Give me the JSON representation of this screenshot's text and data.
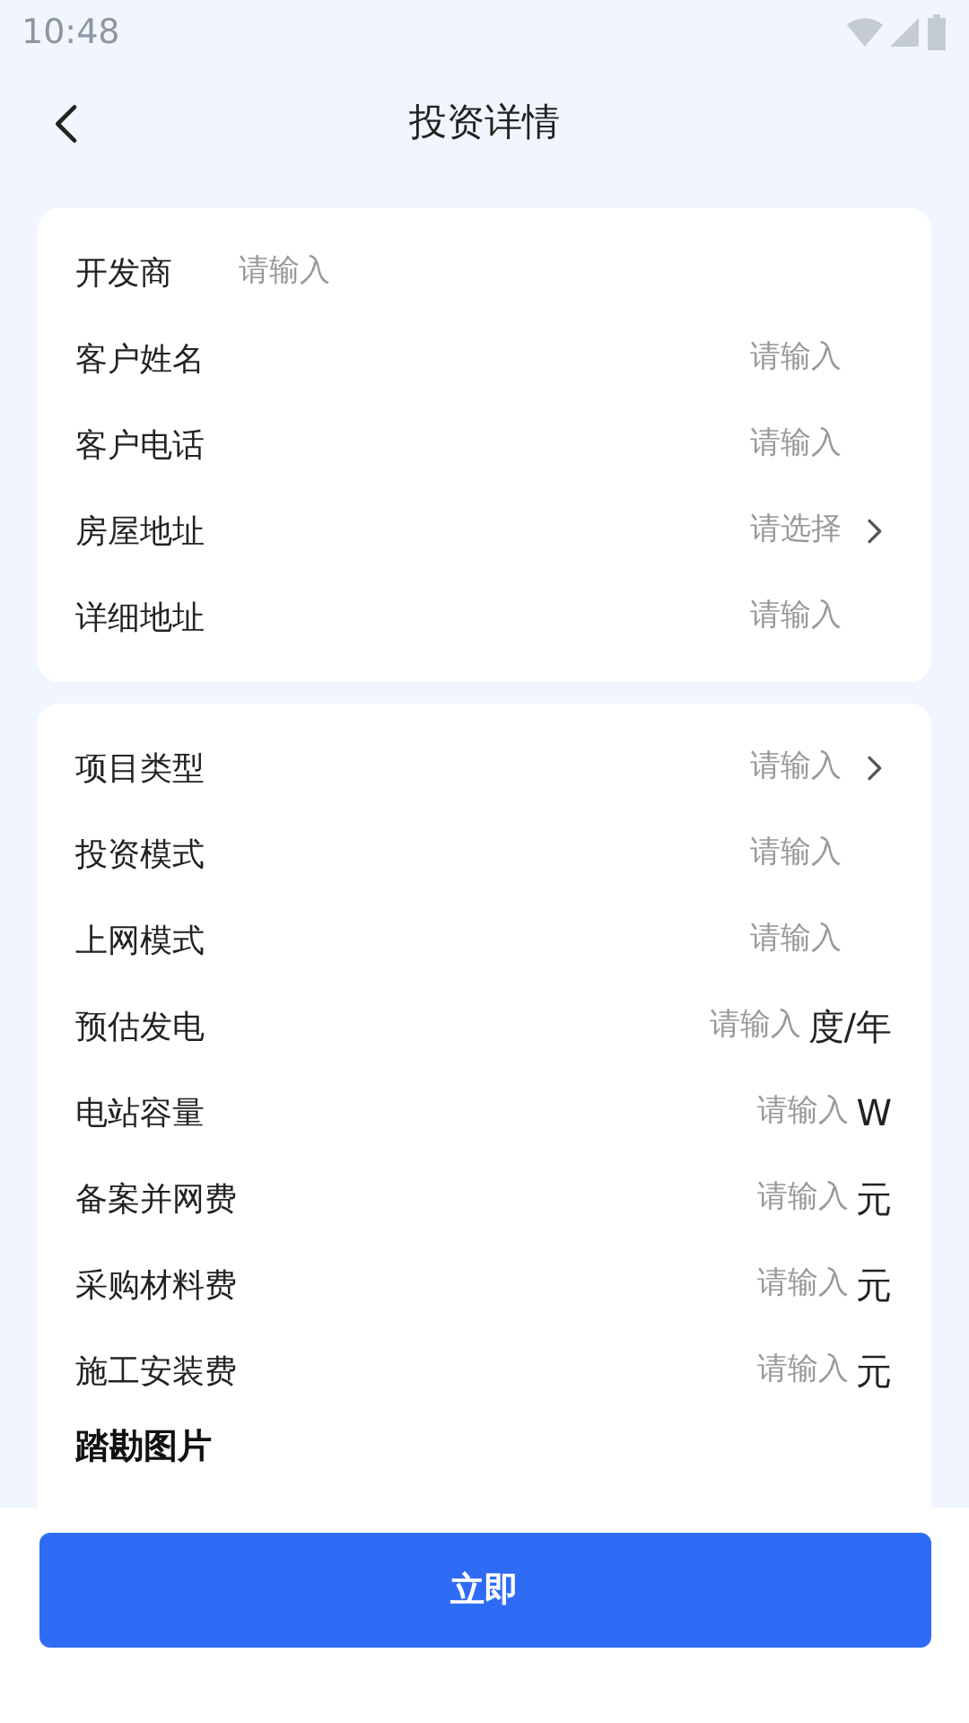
{
  "status_bar": {
    "time": "10:48"
  },
  "header": {
    "title": "投资详情"
  },
  "sections": [
    {
      "rows": [
        {
          "label": "开发商",
          "kind": "inline",
          "placeholder": "请输入"
        },
        {
          "label": "客户姓名",
          "kind": "input",
          "placeholder": "请输入"
        },
        {
          "label": "客户电话",
          "kind": "input",
          "placeholder": "请输入"
        },
        {
          "label": "房屋地址",
          "kind": "select",
          "placeholder": "请选择"
        },
        {
          "label": "详细地址",
          "kind": "input",
          "placeholder": "请输入"
        }
      ]
    },
    {
      "rows": [
        {
          "label": "项目类型",
          "kind": "select",
          "placeholder": "请输入"
        },
        {
          "label": "投资模式",
          "kind": "input",
          "placeholder": "请输入"
        },
        {
          "label": "上网模式",
          "kind": "input",
          "placeholder": "请输入"
        },
        {
          "label": "预估发电",
          "kind": "input",
          "placeholder": "请输入",
          "unit": "度/年"
        },
        {
          "label": "电站容量",
          "kind": "input",
          "placeholder": "请输入",
          "unit": "W"
        },
        {
          "label": "备案并网费",
          "kind": "input",
          "placeholder": "请输入",
          "unit": "元"
        },
        {
          "label": "采购材料费",
          "kind": "input",
          "placeholder": "请输入",
          "unit": "元"
        },
        {
          "label": "施工安装费",
          "kind": "input",
          "placeholder": "请输入",
          "unit": "元"
        }
      ],
      "heading": "踏勘图片"
    }
  ],
  "submit_button": "立即"
}
